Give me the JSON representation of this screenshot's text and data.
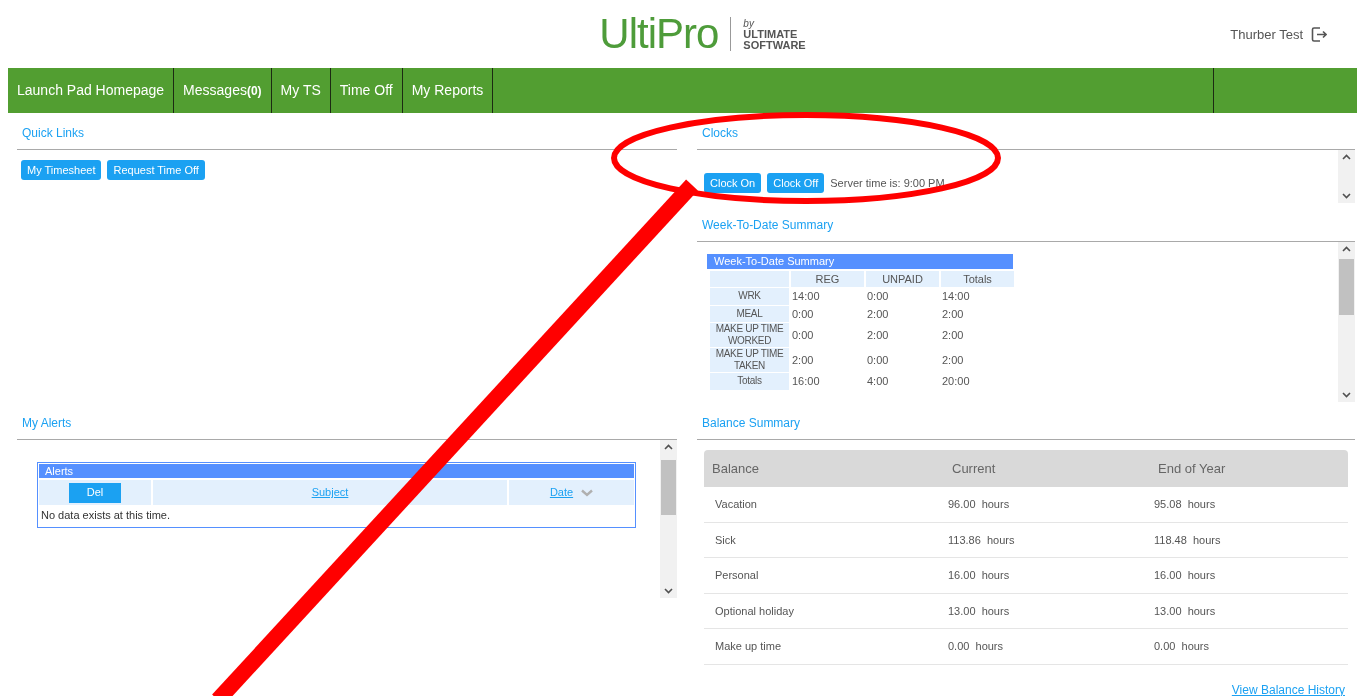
{
  "header": {
    "logo": {
      "name": "UltiPro",
      "by": "by",
      "line_1": "ULTIMATE",
      "line_2": "SOFTWARE"
    },
    "user": "Thurber Test"
  },
  "nav": [
    {
      "label": "Launch Pad Homepage"
    },
    {
      "label": "Messages",
      "count": "(0)"
    },
    {
      "label": "My TS"
    },
    {
      "label": "Time Off"
    },
    {
      "label": "My Reports"
    }
  ],
  "quick_links": {
    "title": "Quick Links",
    "buttons": [
      "My Timesheet",
      "Request Time Off"
    ]
  },
  "clocks": {
    "title": "Clocks",
    "buttons": [
      "Clock On",
      "Clock Off"
    ],
    "server_time": "Server time is: 9:00 PM"
  },
  "week_to_date": {
    "title": "Week-To-Date Summary",
    "table": {
      "caption": "Week-To-Date Summary",
      "columns": [
        "REG",
        "UNPAID",
        "Totals"
      ],
      "rows": [
        {
          "label": "WRK",
          "values": [
            "14:00",
            "0:00",
            "14:00"
          ]
        },
        {
          "label": "MEAL",
          "values": [
            "0:00",
            "2:00",
            "2:00"
          ]
        },
        {
          "label": "MAKE UP TIME WORKED",
          "values": [
            "0:00",
            "2:00",
            "2:00"
          ]
        },
        {
          "label": "MAKE UP TIME TAKEN",
          "values": [
            "2:00",
            "0:00",
            "2:00"
          ]
        },
        {
          "label": "Totals",
          "values": [
            "16:00",
            "4:00",
            "20:00"
          ]
        }
      ]
    }
  },
  "my_alerts": {
    "title": "My Alerts",
    "table": {
      "caption": "Alerts",
      "delete_button": "Del",
      "columns": [
        "Subject",
        "Date"
      ],
      "empty_message": "No data exists at this time."
    }
  },
  "balance_summary": {
    "title": "Balance Summary",
    "columns": [
      "Balance",
      "Current",
      "End of Year"
    ],
    "rows": [
      [
        "Vacation",
        "96.00  hours",
        "95.08  hours"
      ],
      [
        "Sick",
        "113.86  hours",
        "118.48  hours"
      ],
      [
        "Personal",
        "16.00  hours",
        "16.00  hours"
      ],
      [
        "Optional holiday",
        "13.00  hours",
        "13.00  hours"
      ],
      [
        "Make up time",
        "0.00  hours",
        "0.00  hours"
      ]
    ],
    "link": "View Balance History"
  }
}
